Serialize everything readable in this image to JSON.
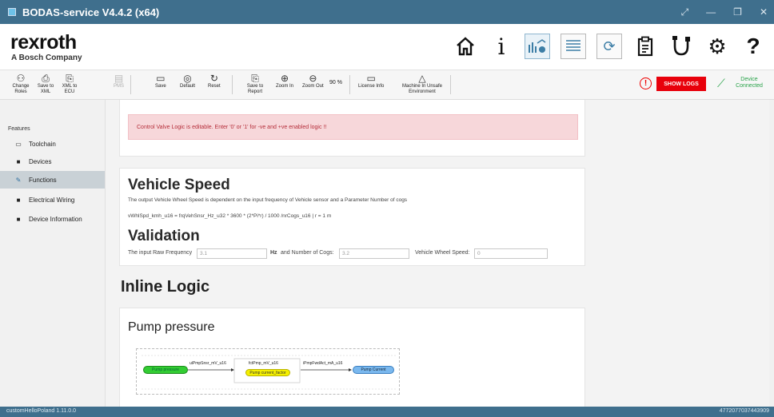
{
  "window": {
    "title": "BODAS-service V4.4.2 (x64)"
  },
  "brand": {
    "name": "rexroth",
    "tagline": "A Bosch Company"
  },
  "toolbar": {
    "change_roles": "Change Roles",
    "save_to_xml": "Save to XML",
    "xml_to_ecu": "XML to ECU",
    "pms": "PMS",
    "save": "Save",
    "default": "Default",
    "reset": "Reset",
    "save_to_report": "Save to Report",
    "zoom_in": "Zoom In",
    "zoom_out": "Zoom Out",
    "zoom_level": "90 %",
    "license_info": "License Info",
    "machine_unsafe": "Machine In Unsafe Environment",
    "show_logs": "SHOW LOGS",
    "device_status": "Device Connected"
  },
  "sidebar": {
    "heading": "Features",
    "items": [
      {
        "label": "Toolchain",
        "icon": "monitor-icon"
      },
      {
        "label": "Devices",
        "icon": "device-icon"
      },
      {
        "label": "Functions",
        "icon": "wrench-icon",
        "active": true
      },
      {
        "label": "Electrical Wiring",
        "icon": "wiring-icon"
      },
      {
        "label": "Device Information",
        "icon": "info-icon"
      }
    ]
  },
  "control_valve": {
    "alert": "Control Valve Logic is editable. Enter '0' or '1' for -ve and +ve enabled logic !!"
  },
  "vehicle_speed": {
    "title": "Vehicle Speed",
    "description": "The output Vehicle Wheel Speed is dependent on the input frequency of Vehicle sensor and a Parameter Number of cogs",
    "formula": "vWhlSpd_kmh_u16 = frqVehSnsr_Hz_u32 * 3600 * (2*Pi*r) / 1000 /nrCogs_u16 | r = 1 m",
    "validation_title": "Validation",
    "raw_freq_label": "The input Raw Frequency",
    "raw_freq_value": "3.1",
    "hz_label": "Hz",
    "cogs_label": "and Number of Cogs:",
    "cogs_value": "3.2",
    "speed_label": "Vehicle Wheel Speed:",
    "speed_value": "0"
  },
  "inline_logic": {
    "title": "Inline Logic",
    "pump_title": "Pump pressure",
    "diagram": {
      "input_label": "Pump pressure",
      "signal_in": "uiPmpSnsr_mV_u16",
      "block_title": "fctPmp_mV_u16",
      "block_param": "Pump current_factor",
      "signal_out": "iPmpFwdAct_mA_u16",
      "output_label": "Pump Current"
    }
  },
  "status": {
    "left": "customHelloPoland 1.11.0.0",
    "right": "4772077037443909"
  }
}
